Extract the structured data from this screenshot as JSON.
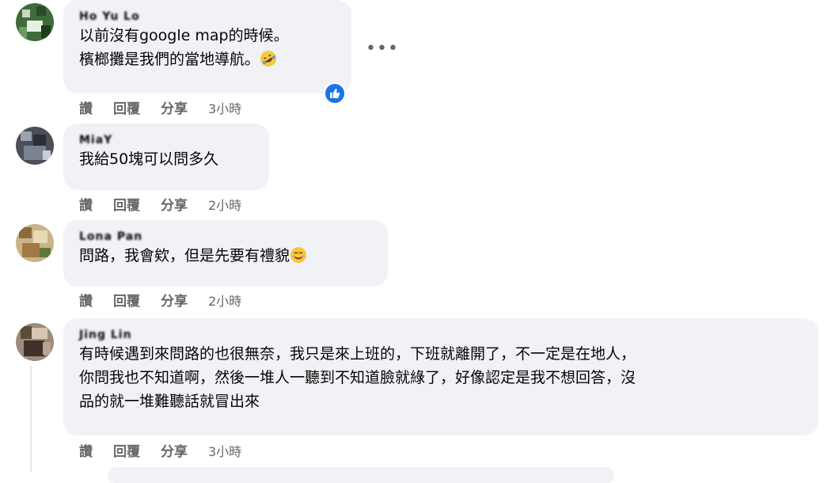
{
  "comments": [
    {
      "author": "Ho Yu Lo",
      "lines": [
        "以前沒有google map的時候。",
        "檳榔攤是我們的當地導航。"
      ],
      "emoji": "rolling-laughing-emoji",
      "reaction": "like-reaction-icon",
      "actions": {
        "like": "讚",
        "reply": "回覆",
        "share": "分享",
        "time": "3小時"
      }
    },
    {
      "author": "MiaY",
      "lines": [
        "我給50塊可以問多久"
      ],
      "actions": {
        "like": "讚",
        "reply": "回覆",
        "share": "分享",
        "time": "2小時"
      }
    },
    {
      "author": "Lona Pan",
      "lines": [
        "問路，我會欸，但是先要有禮貌"
      ],
      "emoji": "smiling-face-emoji",
      "actions": {
        "like": "讚",
        "reply": "回覆",
        "share": "分享",
        "time": "2小時"
      }
    },
    {
      "author": "Jing Lin",
      "lines": [
        "有時候遇到來問路的也很無奈，我只是來上班的，下班就離開了，不一定是在地人，",
        "你問我也不知道啊，然後一堆人一聽到不知道臉就綠了，好像認定是我不想回答，沒",
        "品的就一堆難聽話就冒出來"
      ],
      "actions": {
        "like": "讚",
        "reply": "回覆",
        "share": "分享",
        "time": "3小時"
      }
    }
  ],
  "icons": {
    "more": "more-options-icon",
    "like_color": "#1b74e4"
  },
  "more_label": "•••"
}
